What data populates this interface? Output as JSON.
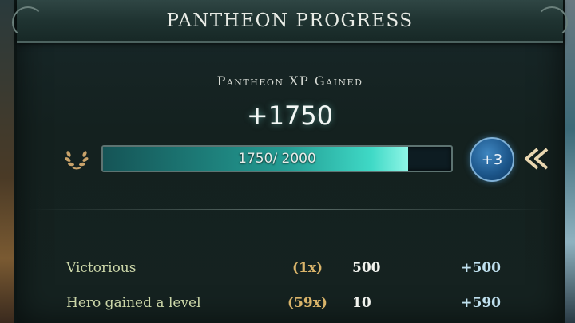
{
  "window": {
    "title": "PANTHEON PROGRESS"
  },
  "xp": {
    "label": "Pantheon XP Gained",
    "gained": "+1750",
    "bar_text": "1750/ 2000",
    "current": 1750,
    "max": 2000,
    "level_badge": "+3"
  },
  "rows": [
    {
      "label": "Victorious",
      "multiplier": "(1x)",
      "base": "500",
      "total": "+500"
    },
    {
      "label": "Hero gained a level",
      "multiplier": "(59x)",
      "base": "10",
      "total": "+590"
    }
  ],
  "icons": {
    "laurel": "laurel-wreath-icon",
    "chevron": "double-chevron-left-icon"
  },
  "colors": {
    "bar_fill": "#3fd9c6",
    "badge": "#1b5488",
    "multiplier": "#d9b46a",
    "row_label": "#cbd6a8",
    "laurel": "#c8a26a"
  }
}
